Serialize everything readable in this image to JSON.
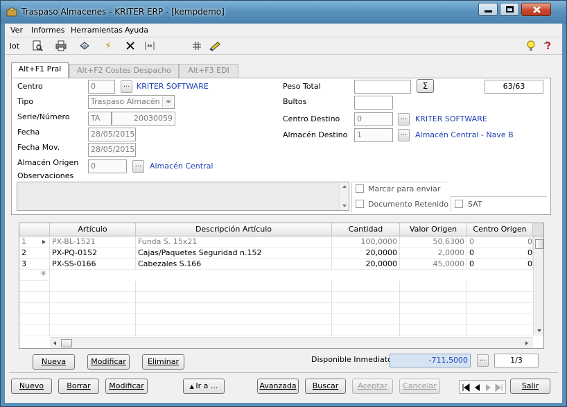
{
  "window": {
    "title": "Traspaso Almacenes - KRITER ERP - [kempdemo]"
  },
  "menu": [
    "Ver",
    "Informes",
    "Herramientas",
    "Ayuda"
  ],
  "toolbar": {
    "lot_label": "lot"
  },
  "tabs": [
    {
      "label": "Alt+F1 Pral"
    },
    {
      "label": "Alt+F2 Costes Despacho"
    },
    {
      "label": "Alt+F3 EDI"
    }
  ],
  "form": {
    "centro": {
      "label": "Centro",
      "value": "0",
      "name": "KRITER SOFTWARE"
    },
    "tipo": {
      "label": "Tipo",
      "value": "Traspaso Almacén"
    },
    "serie": {
      "label": "Serie/Número",
      "serie": "TA",
      "numero": "20030059"
    },
    "fecha": {
      "label": "Fecha",
      "value": "28/05/2015"
    },
    "fecha_mov": {
      "label": "Fecha Mov.",
      "value": "28/05/2015"
    },
    "almacen_origen": {
      "label": "Almacén Origen",
      "value": "0",
      "name": "Almacén Central"
    },
    "observaciones": {
      "label": "Observaciones"
    },
    "peso_total": {
      "label": "Peso Total",
      "value": ""
    },
    "sigma": "Σ",
    "counter": "63/63",
    "bultos": {
      "label": "Bultos",
      "value": ""
    },
    "centro_destino": {
      "label": "Centro Destino",
      "value": "0",
      "name": "KRITER SOFTWARE"
    },
    "almacen_destino": {
      "label": "Almacén Destino",
      "value": "1",
      "name": "Almacén Central - Nave B"
    },
    "marcar": "Marcar para enviar",
    "retenido": "Documento Retenido",
    "sat": "SAT",
    "dots": "..."
  },
  "grid": {
    "headers": [
      "Artículo",
      "Descripción Artículo",
      "Cantidad",
      "Valor Origen",
      "Centro Origen"
    ],
    "rows": [
      {
        "n": "1",
        "art": "PX-BL-1521",
        "desc": "Funda S. 15x21",
        "cant": "100,0000",
        "valor": "50,6300",
        "centro": "0",
        "extra": "0"
      },
      {
        "n": "2",
        "art": "PX-PQ-0152",
        "desc": "Cajas/Paquetes Seguridad n.152",
        "cant": "20,0000",
        "valor": "2,0000",
        "centro": "0",
        "extra": "0"
      },
      {
        "n": "3",
        "art": "PX-SS-0166",
        "desc": "Cabezales S.166",
        "cant": "20,0000",
        "valor": "45,0000",
        "centro": "0",
        "extra": "0"
      }
    ]
  },
  "detail_buttons": {
    "nueva": "Nueva",
    "modificar": "Modificar",
    "eliminar": "Eliminar"
  },
  "disponible": {
    "label": "Disponible Inmediato",
    "value": "-711,5000",
    "page": "1/3"
  },
  "footer": {
    "nuevo": "Nuevo",
    "borrar": "Borrar",
    "modificar": "Modificar",
    "ira": "Ir a ...",
    "avanzada": "Avanzada",
    "buscar": "Buscar",
    "aceptar": "Aceptar",
    "cancelar": "Cancelar",
    "salir": "Salir"
  },
  "colors": {
    "link": "#1e3fb4",
    "title_bar": "#5b93bd",
    "close_button": "#c84a30",
    "disponible_value": "#1e3fb4"
  }
}
